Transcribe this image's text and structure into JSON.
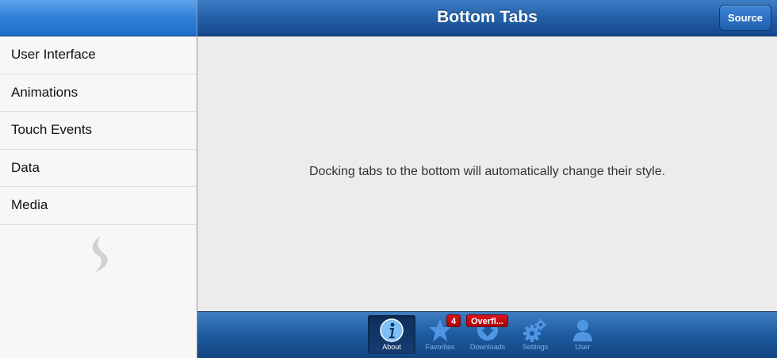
{
  "sidebar": {
    "items": [
      {
        "label": "User Interface"
      },
      {
        "label": "Animations"
      },
      {
        "label": "Touch Events"
      },
      {
        "label": "Data"
      },
      {
        "label": "Media"
      }
    ],
    "logo_icon": "sencha-logo-icon"
  },
  "header": {
    "title": "Bottom Tabs",
    "source_label": "Source"
  },
  "main": {
    "message": "Docking tabs to the bottom will automatically change their style."
  },
  "tabbar": {
    "tabs": [
      {
        "label": "About",
        "icon": "info-icon",
        "active": true
      },
      {
        "label": "Favorites",
        "icon": "star-icon",
        "badge": "4"
      },
      {
        "label": "Downloads",
        "icon": "download-icon",
        "badge": "Overfl..."
      },
      {
        "label": "Settings",
        "icon": "gears-icon"
      },
      {
        "label": "User",
        "icon": "user-icon"
      }
    ]
  },
  "colors": {
    "accent": "#235fa8",
    "badge": "#c80a0f",
    "tab_inactive_label": "#7fb0e6"
  }
}
